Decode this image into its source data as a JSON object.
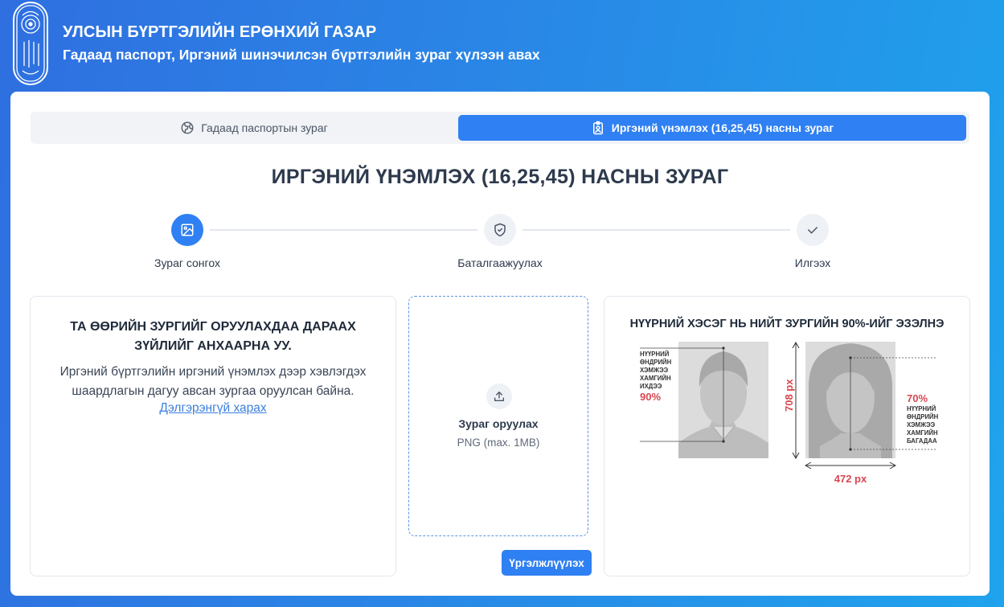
{
  "header": {
    "org_title": "УЛСЫН БҮРТГЭЛИЙН ЕРӨНХИЙ ГАЗАР",
    "subtitle": "Гадаад паспорт, Иргэний шинэчилсэн бүртгэлийн зураг хүлээн авах",
    "emblem_icon": "state-emblem-icon"
  },
  "tabs": [
    {
      "label": "Гадаад паспортын зураг",
      "icon": "globe-icon",
      "active": false
    },
    {
      "label": "Иргэний үнэмлэх (16,25,45) насны зураг",
      "icon": "id-badge-icon",
      "active": true
    }
  ],
  "page_heading": "ИРГЭНИЙ ҮНЭМЛЭХ (16,25,45) НАСНЫ ЗУРАГ",
  "stepper": [
    {
      "label": "Зураг сонгох",
      "icon": "image-icon",
      "state": "active"
    },
    {
      "label": "Баталгаажуулах",
      "icon": "shield-check-icon",
      "state": "inactive"
    },
    {
      "label": "Илгээх",
      "icon": "check-icon",
      "state": "inactive"
    }
  ],
  "info": {
    "heading": "ТА ӨӨРИЙН ЗУРГИЙГ ОРУУЛАХДАА ДАРААХ ЗҮЙЛИЙГ АНХААРНА УУ.",
    "text": "Иргэний бүртгэлийн иргэний үнэмлэх дээр хэвлэгдэх шаардлагын дагуу авсан зургаа оруулсан байна.",
    "link": "Дэлгэрэнгүй харах"
  },
  "upload": {
    "icon": "upload-icon",
    "label": "Зураг оруулах",
    "hint": "PNG (max. 1MB)"
  },
  "continue_label": "Үргэлжлүүлэх",
  "guide": {
    "title": "НҮҮРНИЙ ХЭСЭГ НЬ НИЙТ ЗУРГИЙН 90%-ИЙГ ЭЗЭЛНЭ",
    "left_note": [
      "НҮҮРНИЙ",
      "ӨНДРИЙН",
      "ХЭМЖЭЭ",
      "ХАМГИЙН",
      "ИХДЭЭ"
    ],
    "left_percent": "90%",
    "height_label": "708 px",
    "right_percent": "70%",
    "right_note": [
      "НҮҮРНИЙ",
      "ӨНДРИЙН",
      "ХЭМЖЭЭ",
      "ХАМГИЙН",
      "БАГАДАА"
    ],
    "width_label": "472 px"
  },
  "colors": {
    "primary": "#2f80f2",
    "accent_red": "#d8474f",
    "background_from": "#2f6fe0",
    "background_to": "#1fa3ec"
  }
}
